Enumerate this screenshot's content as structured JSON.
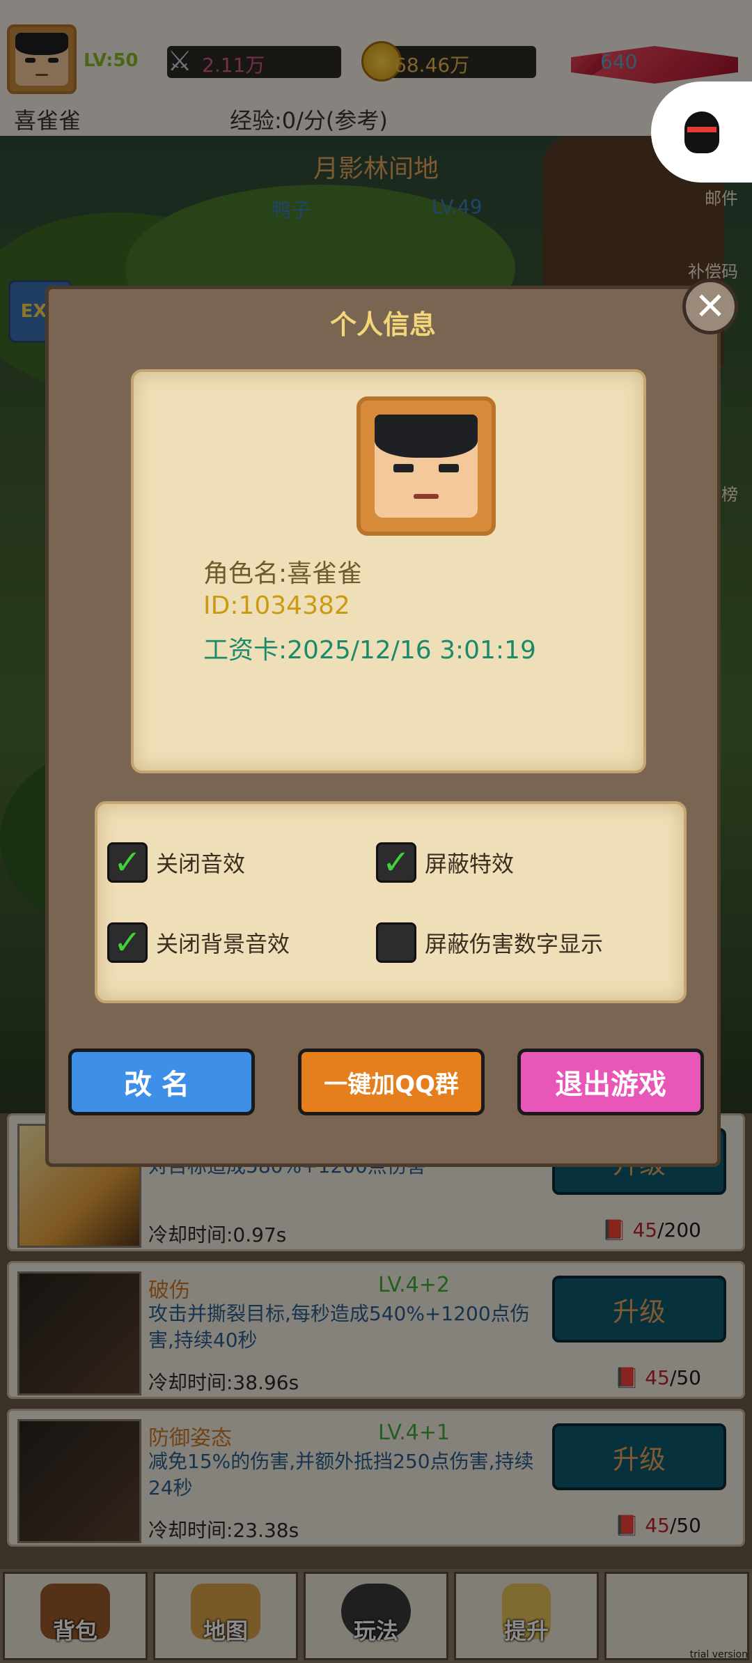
{
  "hud": {
    "level": "LV:50",
    "attack": "2.11万",
    "gold": "68.46万",
    "gems": "640",
    "player_name": "喜雀雀",
    "exp_rate": "经验:0/分(参考)",
    "icons": {
      "attack": "crossed-swords-icon",
      "gold": "coin-icon",
      "gem": "gem-icon",
      "qq": "qq-penguin-icon"
    }
  },
  "scene": {
    "map_name": "月影林间地",
    "enemy_name": "鸭子",
    "enemy_level": "LV.49",
    "exp_badge": "EXP",
    "side_labels": {
      "mail": "邮件",
      "compensation": "补偿码",
      "ranking": "榜"
    }
  },
  "dialog": {
    "title": "个人信息",
    "info": {
      "name": "角色名:喜雀雀",
      "id": "ID:1034382",
      "wage_card": "工资卡:2025/12/16 3:01:19"
    },
    "options": [
      {
        "label": "关闭音效",
        "checked": true
      },
      {
        "label": "屏蔽特效",
        "checked": true
      },
      {
        "label": "关闭背景音效",
        "checked": true
      },
      {
        "label": "屏蔽伤害数字显示",
        "checked": false
      }
    ],
    "buttons": {
      "rename": "改名",
      "join_qq": "一键加QQ群",
      "quit": "退出游戏"
    }
  },
  "skills": [
    {
      "name": "",
      "level": "",
      "desc": "对目标造成580%+1200点伤害",
      "cooldown": "冷却时间:0.97s",
      "cost_have": "45",
      "cost_need": "/200",
      "button": "升级"
    },
    {
      "name": "破伤",
      "level": "LV.4+2",
      "desc": "攻击并撕裂目标,每秒造成540%+1200点伤害,持续40秒",
      "cooldown": "冷却时间:38.96s",
      "cost_have": "45",
      "cost_need": "/50",
      "button": "升级"
    },
    {
      "name": "防御姿态",
      "level": "LV.4+1",
      "desc": "减免15%的伤害,并额外抵挡250点伤害,持续24秒",
      "cooldown": "冷却时间:23.38s",
      "cost_have": "45",
      "cost_need": "/50",
      "button": "升级"
    }
  ],
  "nav": [
    {
      "label": "背包",
      "icon": "backpack-icon"
    },
    {
      "label": "地图",
      "icon": "map-scroll-icon"
    },
    {
      "label": "玩法",
      "icon": "gamepad-icon"
    },
    {
      "label": "提升",
      "icon": "fist-icon"
    },
    {
      "label": "",
      "icon": ""
    }
  ],
  "watermark": "trial version",
  "colors": {
    "accent_gold": "#f3d67a",
    "check_green": "#3fd23a",
    "rename_blue": "#3d8fe8",
    "qq_orange": "#e57e1c",
    "quit_pink": "#e857b8"
  }
}
